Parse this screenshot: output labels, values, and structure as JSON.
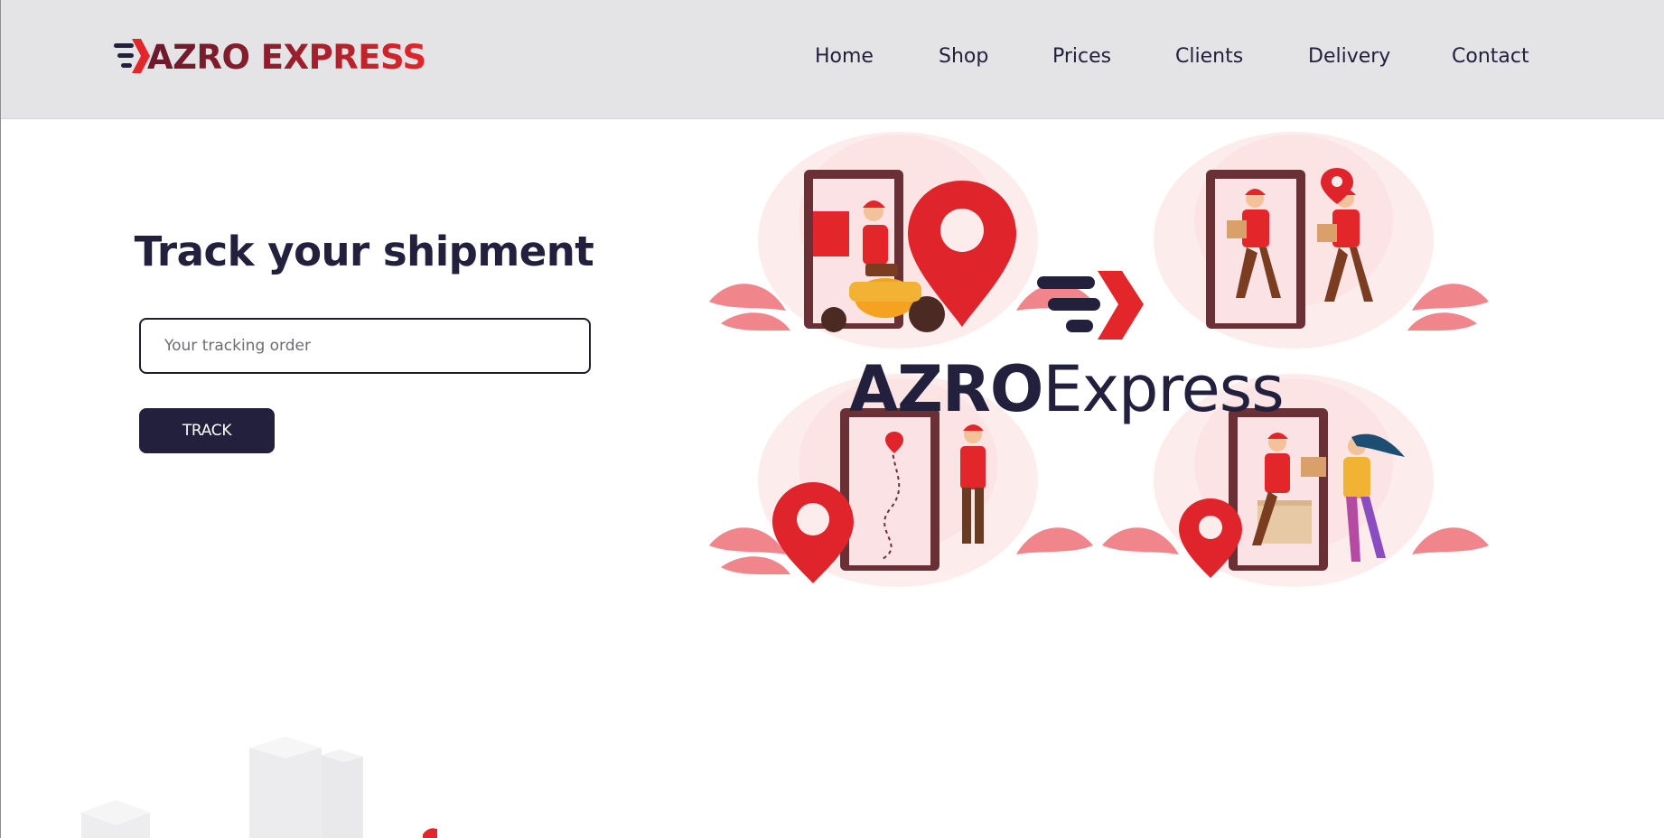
{
  "brand": {
    "name": "AZRO EXPRESS",
    "logo_icon": "arrow-lines-icon",
    "gradient": [
      "#6b1a2c",
      "#e3262a"
    ]
  },
  "nav": {
    "items": [
      {
        "label": "Home"
      },
      {
        "label": "Shop"
      },
      {
        "label": "Prices"
      },
      {
        "label": "Clients"
      },
      {
        "label": "Delivery"
      },
      {
        "label": "Contact"
      }
    ]
  },
  "tracking": {
    "title": "Track your shipment",
    "input_value": "",
    "input_placeholder": "Your tracking order",
    "button_label": "TRACK"
  },
  "hero": {
    "wordmark_bold": "AZRO",
    "wordmark_light": "Express",
    "illustrations": [
      "courier-scooter",
      "courier-running",
      "courier-map-phone",
      "courier-package-handoff"
    ]
  },
  "colors": {
    "navy": "#22203d",
    "red": "#e3262a",
    "navbar_bg": "#e4e4e6",
    "pink_soft": "#fde7e8"
  }
}
